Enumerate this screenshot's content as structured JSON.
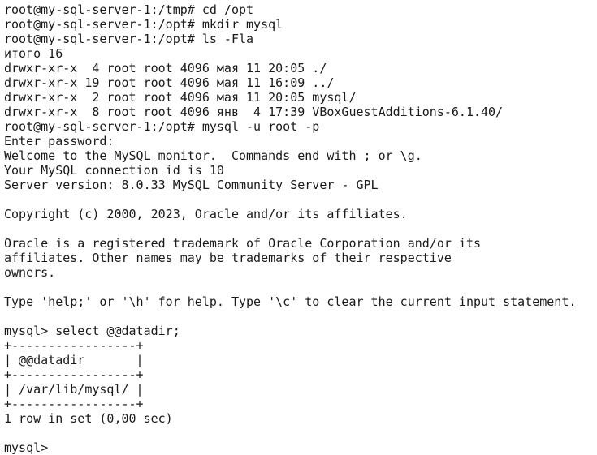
{
  "terminal": {
    "lines": [
      "root@my-sql-server-1:/tmp# cd /opt",
      "root@my-sql-server-1:/opt# mkdir mysql",
      "root@my-sql-server-1:/opt# ls -Fla",
      "итого 16",
      "drwxr-xr-x  4 root root 4096 мая 11 20:05 ./",
      "drwxr-xr-x 19 root root 4096 мая 11 16:09 ../",
      "drwxr-xr-x  2 root root 4096 мая 11 20:05 mysql/",
      "drwxr-xr-x  8 root root 4096 янв  4 17:39 VBoxGuestAdditions-6.1.40/",
      "root@my-sql-server-1:/opt# mysql -u root -p",
      "Enter password:",
      "Welcome to the MySQL monitor.  Commands end with ; or \\g.",
      "Your MySQL connection id is 10",
      "Server version: 8.0.33 MySQL Community Server - GPL",
      "",
      "Copyright (c) 2000, 2023, Oracle and/or its affiliates.",
      "",
      "Oracle is a registered trademark of Oracle Corporation and/or its",
      "affiliates. Other names may be trademarks of their respective",
      "owners.",
      "",
      "Type 'help;' or '\\h' for help. Type '\\c' to clear the current input statement.",
      "",
      "mysql> select @@datadir;",
      "+-----------------+",
      "| @@datadir       |",
      "+-----------------+",
      "| /var/lib/mysql/ |",
      "+-----------------+",
      "1 row in set (0,00 sec)",
      "",
      "mysql> "
    ]
  }
}
